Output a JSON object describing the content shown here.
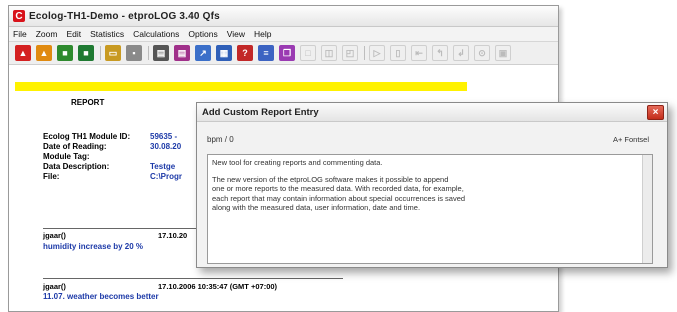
{
  "window": {
    "logo_glyph": "C",
    "title": "Ecolog-TH1-Demo - etproLOG 3.40 Qfs"
  },
  "menu": [
    "File",
    "Zoom",
    "Edit",
    "Statistics",
    "Calculations",
    "Options",
    "View",
    "Help"
  ],
  "toolbar_icons": [
    {
      "name": "red-person-icon",
      "color": "#d42020"
    },
    {
      "name": "orange-person-icon",
      "color": "#e08a10"
    },
    {
      "name": "green-chip-icon",
      "color": "#2e8a2e"
    },
    {
      "name": "green-device-icon",
      "color": "#1f7a32"
    },
    {
      "name": "folder-open-icon",
      "color": "#c89a22"
    },
    {
      "name": "save-icon",
      "color": "#8a8a8a"
    },
    {
      "name": "print-icon",
      "color": "#555555"
    },
    {
      "name": "print-preview-icon",
      "color": "#a0308a"
    },
    {
      "name": "chart-icon",
      "color": "#3b6fc9"
    },
    {
      "name": "table-icon",
      "color": "#2f5fb8"
    },
    {
      "name": "help-icon",
      "color": "#c22828"
    },
    {
      "name": "report-icon",
      "color": "#3c63c2"
    },
    {
      "name": "copy-icon",
      "color": "#9a3ab2"
    }
  ],
  "report": {
    "heading": "REPORT",
    "fields": [
      {
        "label": "Ecolog TH1 Module ID:",
        "value": "59635 -"
      },
      {
        "label": "Date of Reading:",
        "value": "30.08.20"
      },
      {
        "label": "Module Tag:",
        "value": ""
      },
      {
        "label": "Data Description:",
        "value": "Testge"
      },
      {
        "label": "File:",
        "value": "C:\\Progr"
      }
    ],
    "entries": [
      {
        "user": "jgaar()",
        "stamp": "17.10.20",
        "text": "humidity increase by 20 %"
      },
      {
        "user": "jgaar()",
        "stamp": "17.10.2006  10:35:47  (GMT +07:00)",
        "text": "11.07. weather becomes better"
      }
    ]
  },
  "dialog": {
    "title": "Add Custom Report Entry",
    "close_glyph": "×",
    "user_label": "bpm / 0",
    "font_label": "A+ Fontsel",
    "text_lines": [
      "New tool for creating reports and commenting data.",
      "",
      "The new version of the etproLOG software makes it possible to append",
      "one or more reports to the measured data. With recorded data, for example,",
      "each report that may contain information about special occurrences is saved",
      "along with the measured data, user information, date and time."
    ]
  }
}
